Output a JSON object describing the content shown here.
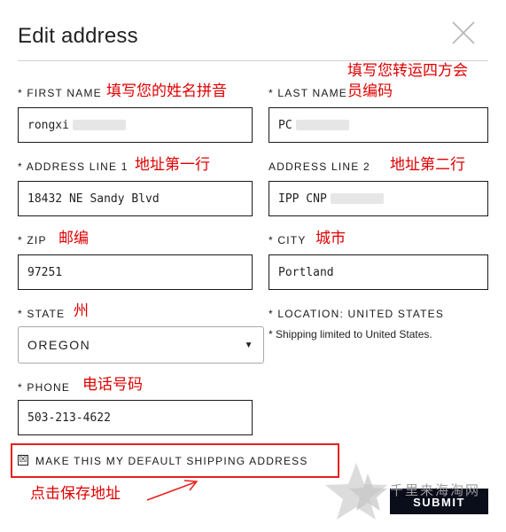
{
  "header": {
    "title": "Edit address"
  },
  "fields": {
    "first_name": {
      "label": "* FIRST NAME",
      "value": "rongxi"
    },
    "last_name": {
      "label": "* LAST NAME",
      "value": "PC"
    },
    "address_line_1": {
      "label": "* ADDRESS LINE 1",
      "value": "18432 NE Sandy Blvd"
    },
    "address_line_2": {
      "label": "ADDRESS LINE 2",
      "value": "IPP CNP"
    },
    "zip": {
      "label": "* ZIP",
      "value": "97251"
    },
    "city": {
      "label": "* CITY",
      "value": "Portland"
    },
    "state": {
      "label": "* STATE",
      "value": "OREGON"
    },
    "location": {
      "label": "* LOCATION: UNITED STATES",
      "note": "* Shipping limited to United States."
    },
    "phone": {
      "label": "* PHONE",
      "value": "503-213-4622"
    }
  },
  "default_checkbox": {
    "label": "MAKE THIS MY DEFAULT SHIPPING ADDRESS",
    "mark": "☒"
  },
  "submit": {
    "label": "SUBMIT"
  },
  "annotations": {
    "first_name": "填写您的姓名拼音",
    "last_name_line1": "填写您转运四方会",
    "last_name_line2": "员编码",
    "address_line_1": "地址第一行",
    "address_line_2": "地址第二行",
    "zip": "邮编",
    "city": "城市",
    "state": "州",
    "phone": "电话号码",
    "save": "点击保存地址"
  },
  "watermark": {
    "text": "千里来海淘网"
  },
  "colors": {
    "annotation": "#e00000",
    "highlight_box": "#e81e1e",
    "submit_bg": "#0a0d1a"
  }
}
